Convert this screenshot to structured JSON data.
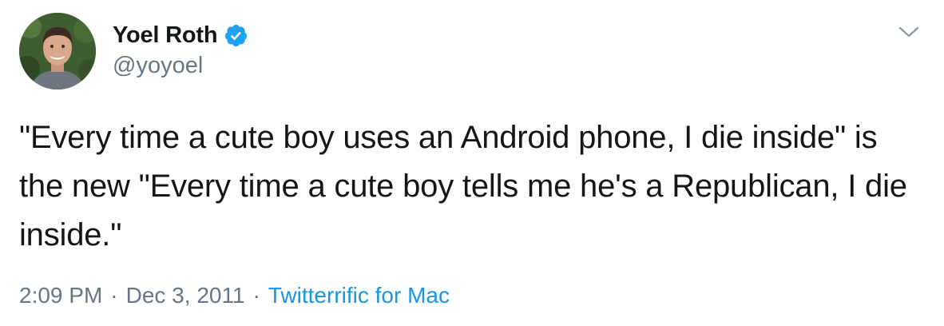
{
  "author": {
    "display_name": "Yoel Roth",
    "handle": "@yoyoel",
    "verified": true,
    "avatar_icon": "profile-photo"
  },
  "tweet": {
    "text": "\"Every time a cute boy uses an Android phone, I die inside\" is the new \"Every time a cute boy tells me he's a Republican, I die inside.\""
  },
  "meta": {
    "time": "2:09 PM",
    "separator": "·",
    "date": "Dec 3, 2011",
    "source": "Twitterrific for Mac"
  },
  "icons": {
    "verified": "verified-badge-icon",
    "menu": "chevron-down-icon"
  },
  "colors": {
    "text": "#14171a",
    "secondary": "#657786",
    "link": "#1b95e0",
    "verified": "#1da1f2"
  }
}
